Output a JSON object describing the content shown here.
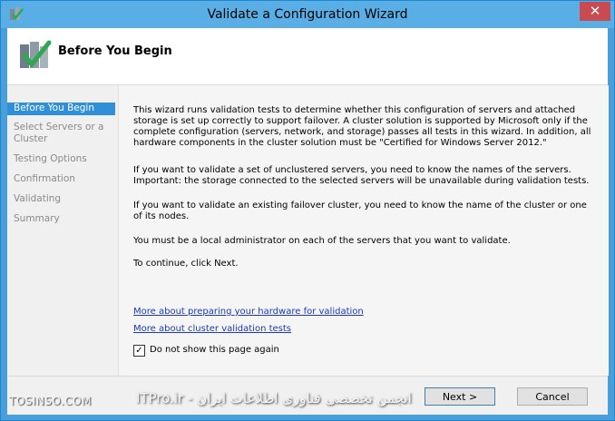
{
  "window": {
    "title": "Validate a Configuration Wizard",
    "close_glyph": "✕"
  },
  "header": {
    "title": "Before You Begin",
    "icon": "cluster-validation-icon"
  },
  "sidebar": {
    "items": [
      {
        "label": "Before You Begin",
        "active": true
      },
      {
        "label": "Select Servers or a Cluster",
        "active": false
      },
      {
        "label": "Testing Options",
        "active": false
      },
      {
        "label": "Confirmation",
        "active": false
      },
      {
        "label": "Validating",
        "active": false
      },
      {
        "label": "Summary",
        "active": false
      }
    ]
  },
  "content": {
    "paragraphs": [
      "This wizard runs validation tests to determine whether this configuration of servers and attached storage is set up correctly to support failover. A cluster solution is supported by Microsoft only if the complete configuration (servers, network, and storage) passes all tests in this wizard. In addition, all hardware components in the cluster solution must be \"Certified for Windows Server 2012.\"",
      "If you want to validate a set of unclustered servers, you need to know the names of the servers. Important: the storage connected to the selected servers will be unavailable during validation tests.",
      "If you want to validate an existing failover cluster, you need to know the name of the cluster or one of its nodes.",
      "You must be a local administrator on each of the servers that you want to validate.",
      "To continue, click Next."
    ],
    "links": [
      "More about preparing your hardware for validation",
      "More about cluster validation tests"
    ],
    "checkbox": {
      "label": "Do not show this page again",
      "checked": true,
      "check_glyph": "✓"
    }
  },
  "footer": {
    "next_label": "Next >",
    "cancel_label": "Cancel"
  },
  "watermark": {
    "left_text": "TOSINSO.COM",
    "right_text": "انجمن تخصصی فناوری اطلاعات ایران - ITPro.ir"
  }
}
